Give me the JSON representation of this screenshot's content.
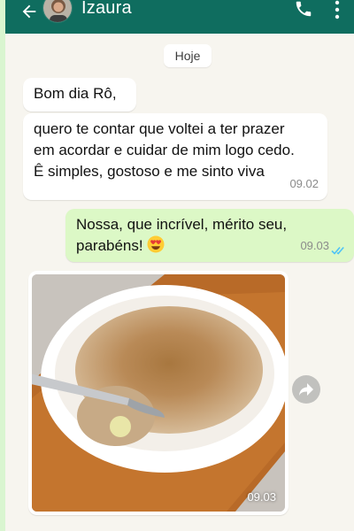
{
  "header": {
    "contact_name": "Izaura",
    "back_icon": "back-arrow-icon",
    "phone_icon": "phone-icon",
    "more_icon": "more-vertical-icon",
    "color": "#0f6d5f"
  },
  "date_chip": "Hoje",
  "messages": [
    {
      "direction": "in",
      "text": "Bom dia Rô,"
    },
    {
      "direction": "in",
      "text": "quero te contar que voltei a ter prazer\nem acordar e cuidar de mim logo cedo.\nÊ simples, gostoso e me sinto viva",
      "time": "09.02"
    },
    {
      "direction": "out",
      "text": "Nossa, que incrível, mérito seu,\nparabéns!",
      "emoji": "heart-eyes-emoji",
      "time": "09.03",
      "status": "read"
    },
    {
      "direction": "in",
      "type": "photo",
      "description_icon": "oatmeal-bowl-photo",
      "time": "09.03"
    }
  ],
  "forward_icon": "forward-icon",
  "colors": {
    "incoming_bubble": "#ffffff",
    "outgoing_bubble": "#dcf8c6",
    "read_ticks": "#4fc3f7",
    "chat_background": "#f7f5ef"
  }
}
